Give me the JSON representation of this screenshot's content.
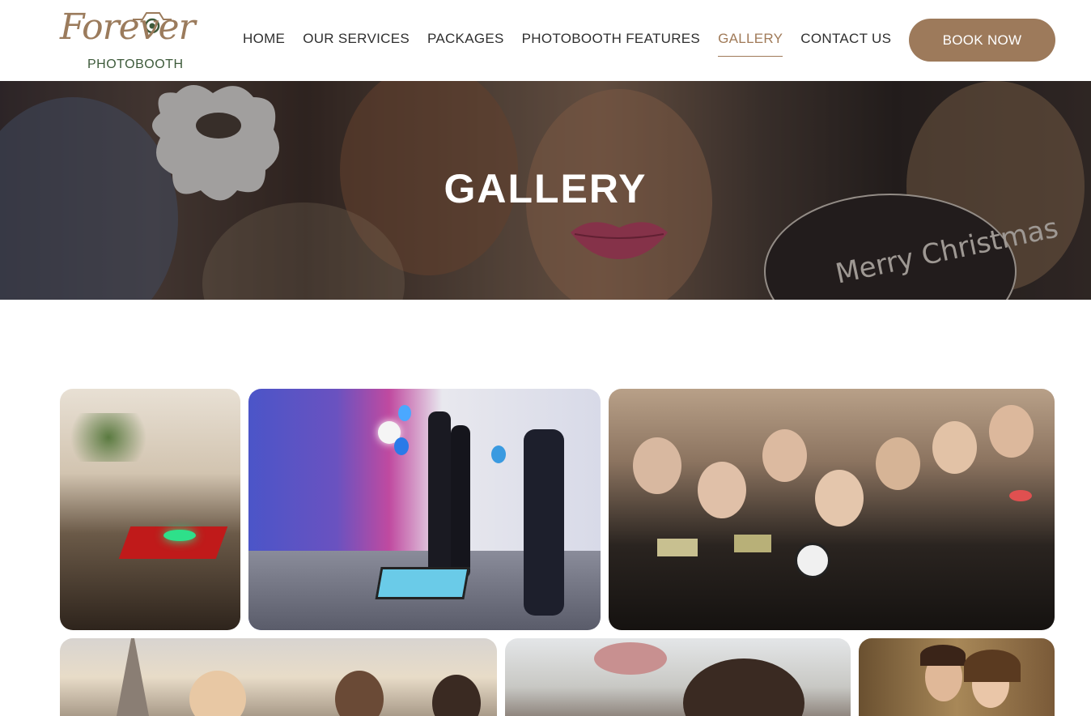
{
  "brand": {
    "logo_script": "Forever",
    "logo_sub": "PHOTOBOOTH",
    "colors": {
      "accent": "#9d7a5b",
      "logo_green": "#3d5a3a",
      "text": "#2f2f2f"
    }
  },
  "nav": {
    "items": [
      {
        "label": "HOME"
      },
      {
        "label": "OUR SERVICES"
      },
      {
        "label": "PACKAGES"
      },
      {
        "label": "PHOTOBOOTH FEATURES"
      },
      {
        "label": "GALLERY",
        "active": true
      },
      {
        "label": "CONTACT US"
      }
    ],
    "cta": "BOOK NOW"
  },
  "hero": {
    "title": "GALLERY",
    "prop_sign_text": "Merry Christmas"
  },
  "gallery": {
    "images": [
      {
        "icon": "photo-venue-360-booth"
      },
      {
        "icon": "photo-360-platform-guests"
      },
      {
        "icon": "photo-group-props"
      },
      {
        "icon": "photo-outdoor-group"
      },
      {
        "icon": "photo-couple-flower-crown"
      },
      {
        "icon": "photo-wedding-couple"
      }
    ]
  }
}
